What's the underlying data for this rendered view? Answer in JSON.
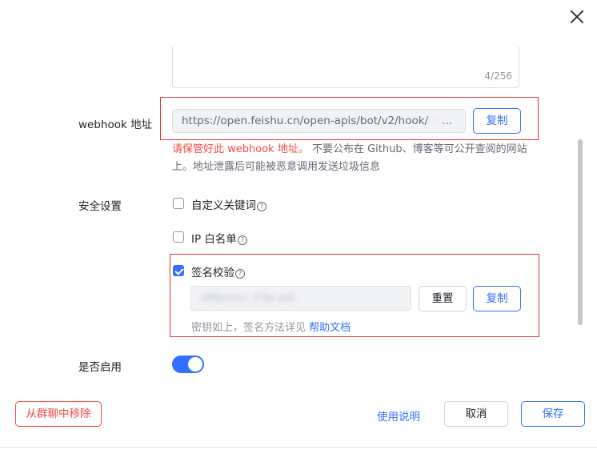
{
  "dialog": {
    "close_icon": "close-icon"
  },
  "description": {
    "counter": "4/256"
  },
  "webhook": {
    "label": "webhook 地址",
    "url": "https://open.feishu.cn/open-apis/bot/v2/hook/",
    "url_masked_tail": "··· ",
    "ellipsis": "...",
    "copy_label": "复制",
    "warning_red": "请保管好此 webhook 地址。",
    "warning_rest": " 不要公布在 Github、博客等可公开查阅的网站上。地址泄露后可能被恶意调用发送垃圾信息"
  },
  "security": {
    "label": "安全设置",
    "keyword_label": "自定义关键词",
    "ip_label": "IP 白名单",
    "sign_label": "签名校验",
    "sign_checked": true,
    "secret_value": "oMjrehLc  XYal  pdl",
    "reset_label": "重置",
    "copy_label": "复制",
    "hint_text": "密钥如上，签名方法详见 ",
    "hint_link": "帮助文档",
    "help_glyph": "?"
  },
  "enable": {
    "label": "是否启用",
    "on": true
  },
  "footer": {
    "remove_label": "从群聊中移除",
    "usage_label": "使用说明",
    "cancel_label": "取消",
    "save_label": "保存"
  },
  "colors": {
    "accent": "#3370ff",
    "danger": "#f54a45",
    "highlight_box": "#d93a3a"
  }
}
